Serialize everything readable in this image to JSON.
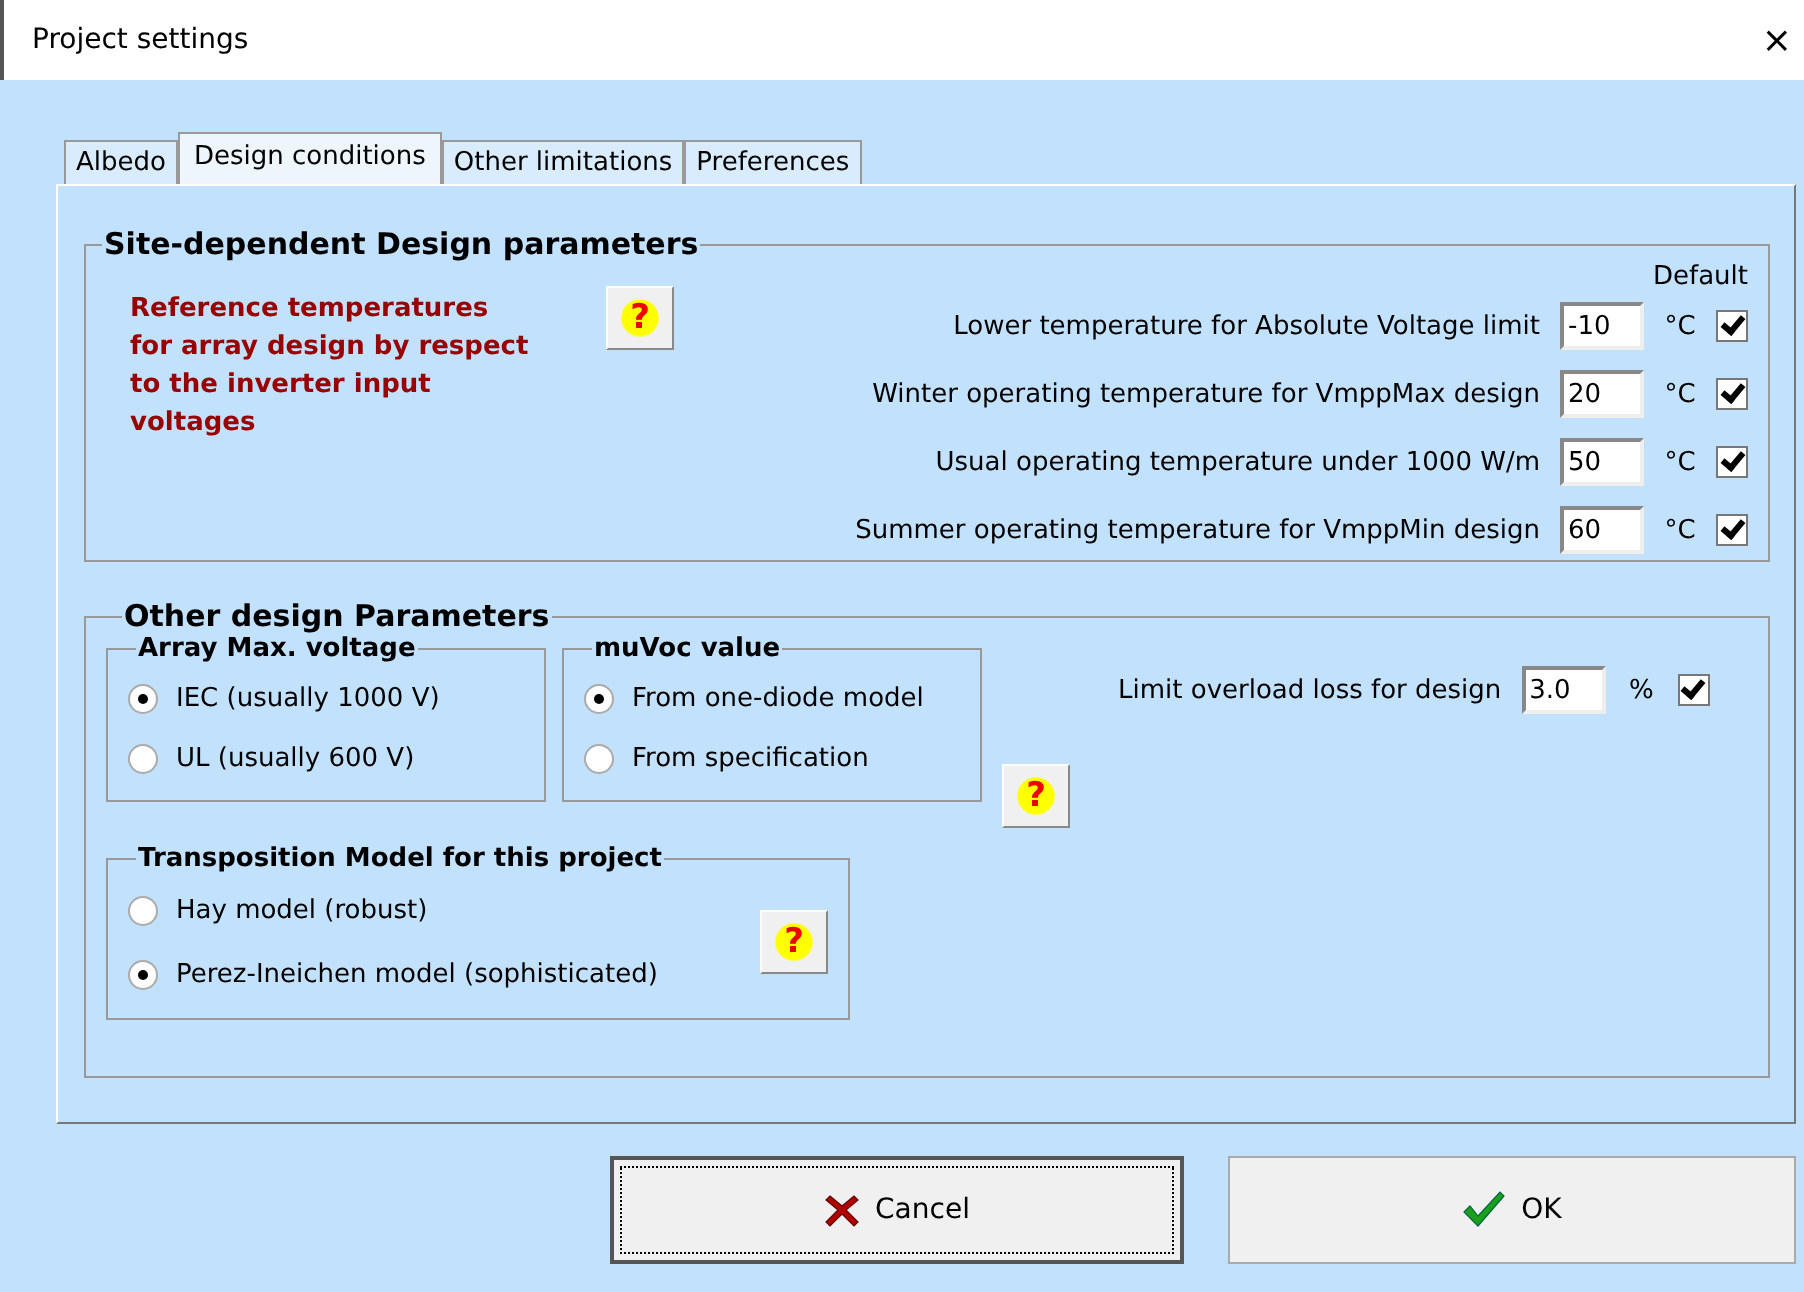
{
  "window": {
    "title": "Project settings",
    "close": "×"
  },
  "tabs": [
    {
      "label": "Albedo",
      "selected": false
    },
    {
      "label": "Design conditions",
      "selected": true
    },
    {
      "label": "Other limitations",
      "selected": false
    },
    {
      "label": "Preferences",
      "selected": false
    }
  ],
  "site_group": {
    "title": "Site-dependent Design parameters",
    "note": "Reference temperatures for array design by respect to the inverter input voltages",
    "help": "?",
    "default_heading": "Default",
    "rows": [
      {
        "label": "Lower temperature for Absolute Voltage  limit",
        "value": "-10",
        "unit": "°C",
        "checked": true
      },
      {
        "label": "Winter operating temperature for VmppMax design",
        "value": "20",
        "unit": "°C",
        "checked": true
      },
      {
        "label": "Usual operating temperature under 1000 W/m",
        "value": "50",
        "unit": "°C",
        "checked": true
      },
      {
        "label": "Summer operating temperature for VmppMin design",
        "value": "60",
        "unit": "°C",
        "checked": true
      }
    ]
  },
  "other_group": {
    "title": "Other design Parameters",
    "array_voltage": {
      "title": "Array Max. voltage",
      "options": [
        {
          "label": "IEC  (usually 1000 V)",
          "selected": true
        },
        {
          "label": "UL   (usually 600 V)",
          "selected": false
        }
      ]
    },
    "muvoc": {
      "title": "muVoc value",
      "options": [
        {
          "label": "From one-diode model",
          "selected": true
        },
        {
          "label": "From specification",
          "selected": false
        }
      ],
      "help": "?"
    },
    "transposition": {
      "title": "Transposition Model for this project",
      "options": [
        {
          "label": "Hay model (robust)",
          "selected": false
        },
        {
          "label": "Perez-Ineichen model (sophisticated)",
          "selected": true
        }
      ],
      "help": "?"
    },
    "overload": {
      "label": "Limit overload loss for design",
      "value": "3.0",
      "unit": "%",
      "checked": true
    }
  },
  "buttons": [
    {
      "kind": "cancel",
      "label": "Cancel"
    },
    {
      "kind": "ok",
      "label": "OK"
    }
  ]
}
